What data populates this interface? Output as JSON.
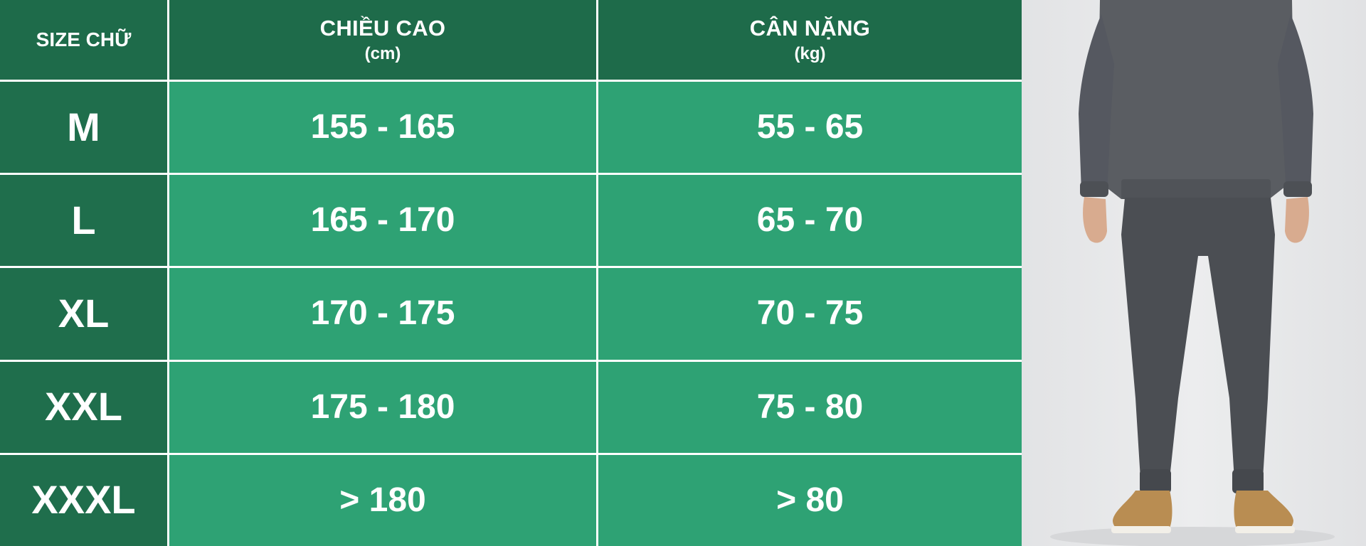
{
  "header": {
    "size_title": "SIZE CHỮ",
    "height_title": "CHIỀU CAO",
    "height_unit": "(cm)",
    "weight_title": "CÂN NẶNG",
    "weight_unit": "(kg)"
  },
  "rows": [
    {
      "size": "M",
      "height": "155 - 165",
      "weight": "55 - 65"
    },
    {
      "size": "L",
      "height": "165 - 170",
      "weight": "65 - 70"
    },
    {
      "size": "XL",
      "height": "170 - 175",
      "weight": "70 - 75"
    },
    {
      "size": "XXL",
      "height": "175 - 180",
      "weight": "75 - 80"
    },
    {
      "size": "XXXL",
      "height": "> 180",
      "weight": "> 80"
    }
  ],
  "colors": {
    "header_bg": "#1e6b4a",
    "size_column_bg": "#1f6e4c",
    "value_cell_bg": "#2ea274",
    "grid_lines": "#ffffff",
    "text": "#ffffff",
    "garment": "#56595e"
  },
  "icons": {
    "model_photo": "model-wearing-grey-tracksuit"
  }
}
